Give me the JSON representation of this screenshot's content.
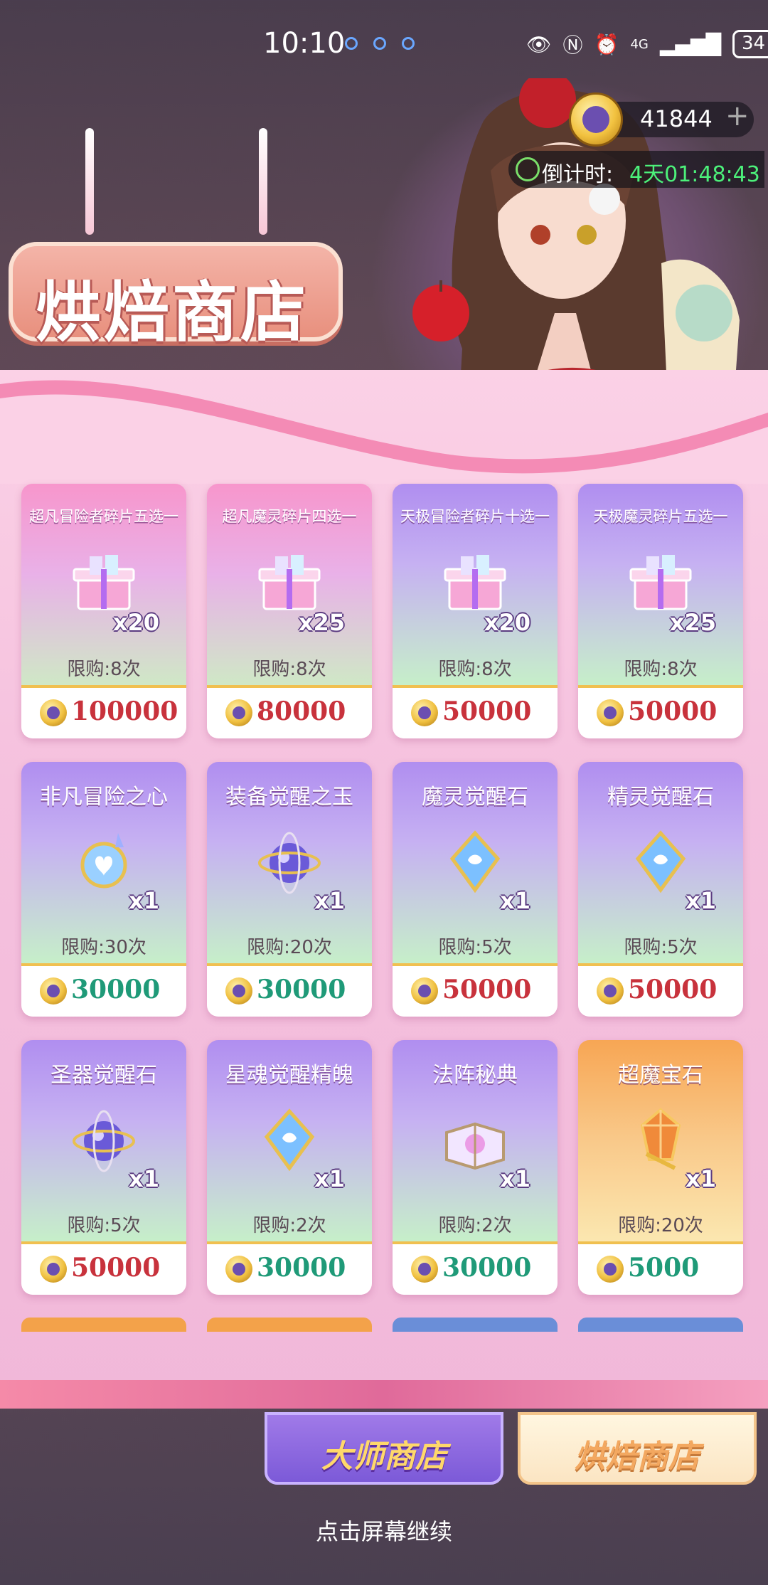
{
  "status_bar": {
    "time": "10:10",
    "battery": "34",
    "network": "4G"
  },
  "currency": {
    "value": "41844",
    "add": "+"
  },
  "countdown": {
    "label": "倒计时:",
    "value": "4天01:48:43"
  },
  "shop_title": "烘焙商店",
  "colors": {
    "price_red": "#c8323c",
    "price_green": "#1f9a78",
    "cd_green": "#4cf07a"
  },
  "items": [
    {
      "name": "超凡冒险者碎片五选一",
      "qty": "x20",
      "limit": "限购:8次",
      "price": "100000",
      "price_color": "red",
      "icon": "gift-box-icon",
      "theme": "pink"
    },
    {
      "name": "超凡魔灵碎片四选一",
      "qty": "x25",
      "limit": "限购:8次",
      "price": "80000",
      "price_color": "red",
      "icon": "gift-box-icon",
      "theme": "pink"
    },
    {
      "name": "天极冒险者碎片十选一",
      "qty": "x20",
      "limit": "限购:8次",
      "price": "50000",
      "price_color": "red",
      "icon": "gift-box-icon",
      "theme": "purple"
    },
    {
      "name": "天极魔灵碎片五选一",
      "qty": "x25",
      "limit": "限购:8次",
      "price": "50000",
      "price_color": "red",
      "icon": "gift-box-icon",
      "theme": "purple"
    },
    {
      "name": "非凡冒险之心",
      "qty": "x1",
      "limit": "限购:30次",
      "price": "30000",
      "price_color": "green",
      "icon": "heart-gem-icon",
      "theme": "purple"
    },
    {
      "name": "装备觉醒之玉",
      "qty": "x1",
      "limit": "限购:20次",
      "price": "30000",
      "price_color": "green",
      "icon": "orb-icon",
      "theme": "purple"
    },
    {
      "name": "魔灵觉醒石",
      "qty": "x1",
      "limit": "限购:5次",
      "price": "50000",
      "price_color": "red",
      "icon": "crystal-icon",
      "theme": "purple"
    },
    {
      "name": "精灵觉醒石",
      "qty": "x1",
      "limit": "限购:5次",
      "price": "50000",
      "price_color": "red",
      "icon": "crystal-icon",
      "theme": "purple"
    },
    {
      "name": "圣器觉醒石",
      "qty": "x1",
      "limit": "限购:5次",
      "price": "50000",
      "price_color": "red",
      "icon": "orb-icon",
      "theme": "purple"
    },
    {
      "name": "星魂觉醒精魄",
      "qty": "x1",
      "limit": "限购:2次",
      "price": "30000",
      "price_color": "green",
      "icon": "crystal-icon",
      "theme": "purple"
    },
    {
      "name": "法阵秘典",
      "qty": "x1",
      "limit": "限购:2次",
      "price": "30000",
      "price_color": "green",
      "icon": "book-icon",
      "theme": "purple"
    },
    {
      "name": "超魔宝石",
      "qty": "x1",
      "limit": "限购:20次",
      "price": "5000",
      "price_color": "green",
      "icon": "gem-icon",
      "theme": "orange"
    }
  ],
  "tabs": {
    "master": "大师商店",
    "bakery": "烘焙商店"
  },
  "hint": "点击屏幕继续"
}
